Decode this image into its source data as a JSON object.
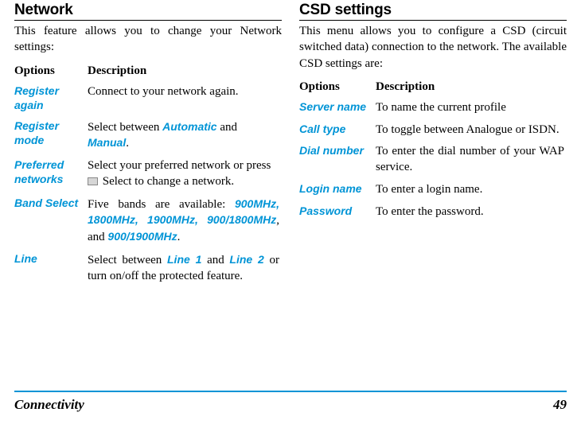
{
  "left": {
    "heading": "Network",
    "intro": "This feature allows you to change your Network settings:",
    "th_options": "Options",
    "th_desc": "Description",
    "rows": [
      {
        "opt": "Register again",
        "desc": "Connect to your network again."
      },
      {
        "opt": "Register mode",
        "desc_pre": "Select between ",
        "link1": "Automatic",
        "mid": " and ",
        "link2": "Manual",
        "post": "."
      },
      {
        "opt": "Preferred networks",
        "line1": "Select your preferred network or press",
        "line2": " Select to change a network."
      },
      {
        "opt": "Band Select",
        "pre": "Five bands are available: ",
        "link1": "900MHz, 1800MHz, 1900MHz, 900/1800MHz",
        "mid": ", and ",
        "link2": "900/1900MHz",
        "post": "."
      },
      {
        "opt": "Line",
        "pre": "Select between ",
        "link1": "Line 1",
        "mid": " and ",
        "link2": "Line 2",
        "post": " or turn on/off the protected feature."
      }
    ]
  },
  "right": {
    "heading": "CSD settings",
    "intro": "This menu allows you to configure a CSD (circuit switched data) connection to the network. The available CSD settings are:",
    "th_options": "Options",
    "th_desc": "Description",
    "rows": [
      {
        "opt": "Server name",
        "desc": "To name the current profile"
      },
      {
        "opt": "Call type",
        "desc": "To toggle between Analogue or ISDN."
      },
      {
        "opt": "Dial number",
        "desc": "To enter the dial number of your WAP service."
      },
      {
        "opt": "Login name",
        "desc": "To enter a login name."
      },
      {
        "opt": "Password",
        "desc": "To enter the password."
      }
    ]
  },
  "footer": {
    "section": "Connectivity",
    "page": "49"
  }
}
